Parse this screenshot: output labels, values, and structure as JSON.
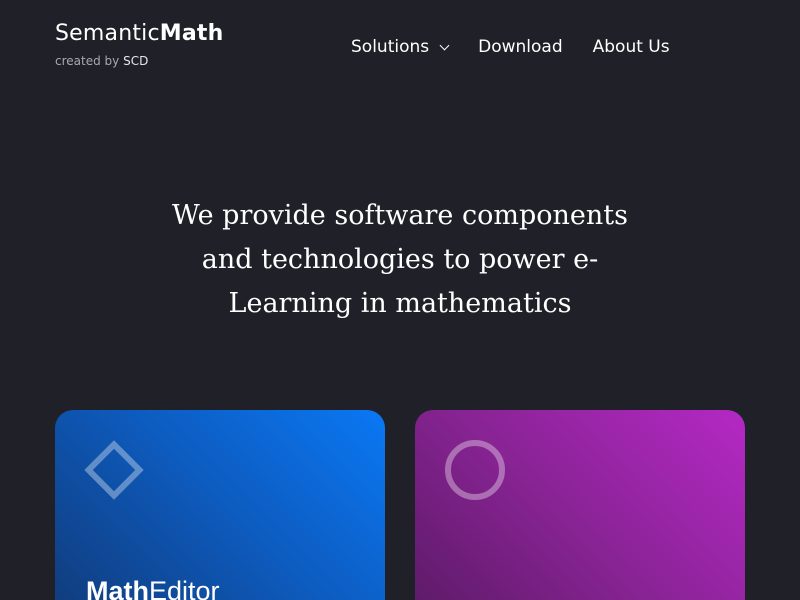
{
  "brand": {
    "name_light": "Semantic",
    "name_bold": "Math",
    "sub_prefix": "created by",
    "sub_name": "SCD"
  },
  "nav": {
    "items": [
      {
        "label": "Solutions"
      },
      {
        "label": "Download"
      },
      {
        "label": "About Us"
      }
    ]
  },
  "hero": {
    "text": "We provide software components and technologies to power e-Learning in mathematics"
  },
  "cards": [
    {
      "title_bold": "Math",
      "title_light": "Editor",
      "icon": "diamond-icon"
    },
    {
      "title_bold": "",
      "title_light": "",
      "icon": "circle-icon"
    }
  ]
}
